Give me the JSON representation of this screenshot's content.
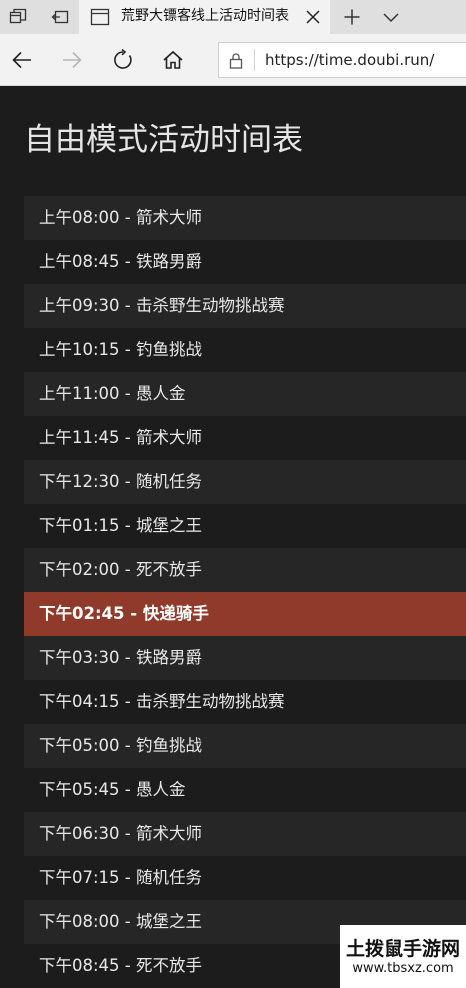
{
  "browser": {
    "tab_title": "荒野大镖客线上活动时间表",
    "url": "https://time.doubi.run/",
    "icons": {
      "tab_actions": "tab-actions-icon",
      "set_aside": "set-aside-tabs-icon",
      "page": "page-icon",
      "close": "close-icon",
      "new_tab": "plus-icon",
      "tab_list": "chevron-down-icon",
      "back": "back-arrow-icon",
      "forward": "forward-arrow-icon",
      "refresh": "refresh-icon",
      "home": "home-icon",
      "lock": "lock-icon"
    }
  },
  "page": {
    "title": "自由模式活动时间表",
    "schedule": [
      {
        "text": "上午08:00 - 箭术大师",
        "active": false
      },
      {
        "text": "上午08:45 - 铁路男爵",
        "active": false
      },
      {
        "text": "上午09:30 - 击杀野生动物挑战赛",
        "active": false
      },
      {
        "text": "上午10:15 - 钓鱼挑战",
        "active": false
      },
      {
        "text": "上午11:00 - 愚人金",
        "active": false
      },
      {
        "text": "上午11:45 - 箭术大师",
        "active": false
      },
      {
        "text": "下午12:30 - 随机任务",
        "active": false
      },
      {
        "text": "下午01:15 - 城堡之王",
        "active": false
      },
      {
        "text": "下午02:00 - 死不放手",
        "active": false
      },
      {
        "text": "下午02:45 - 快递骑手",
        "active": true
      },
      {
        "text": "下午03:30 - 铁路男爵",
        "active": false
      },
      {
        "text": "下午04:15 - 击杀野生动物挑战赛",
        "active": false
      },
      {
        "text": "下午05:00 - 钓鱼挑战",
        "active": false
      },
      {
        "text": "下午05:45 - 愚人金",
        "active": false
      },
      {
        "text": "下午06:30 - 箭术大师",
        "active": false
      },
      {
        "text": "下午07:15 - 随机任务",
        "active": false
      },
      {
        "text": "下午08:00 - 城堡之王",
        "active": false
      },
      {
        "text": "下午08:45 - 死不放手",
        "active": false
      }
    ],
    "colors": {
      "background": "#1c1c1c",
      "row_alt": "#262626",
      "active_row": "#8f3a2b",
      "text": "#e8e8e8"
    }
  },
  "watermark": {
    "title": "土拨鼠手游网",
    "url": "www.tbsxz.com"
  }
}
